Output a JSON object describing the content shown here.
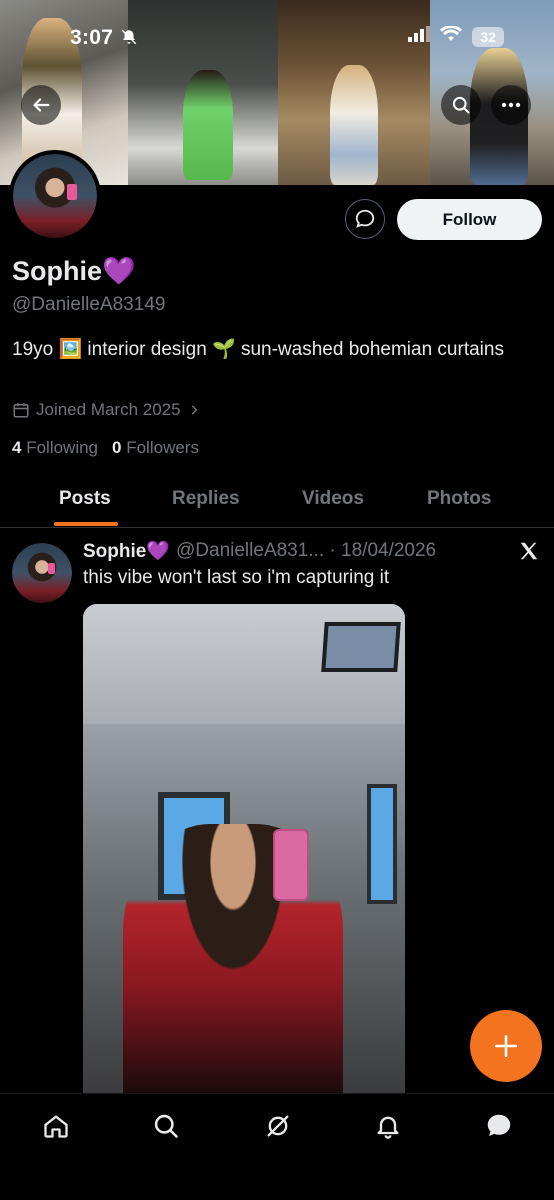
{
  "status_bar": {
    "time": "3:07",
    "battery": "32"
  },
  "profile": {
    "name": "Sophie",
    "name_emoji": "💜",
    "handle": "@DanielleA83149",
    "bio": "19yo 🖼️ interior design 🌱 sun-washed bohemian curtains",
    "joined": "Joined March 2025",
    "following_count": "4",
    "following_label": "Following",
    "followers_count": "0",
    "followers_label": "Followers"
  },
  "actions": {
    "follow_label": "Follow"
  },
  "tabs": [
    {
      "label": "Posts",
      "active": true
    },
    {
      "label": "Replies",
      "active": false
    },
    {
      "label": "Videos",
      "active": false
    },
    {
      "label": "Photos",
      "active": false
    }
  ],
  "post": {
    "author": "Sophie💜",
    "meta": "@DanielleA831... · 18/04/2026",
    "text": "this vibe won't last so i'm capturing it",
    "source_icon": "x-logo-icon"
  },
  "fab": {
    "icon": "plus-icon"
  },
  "bottom_nav": [
    {
      "icon": "home-icon"
    },
    {
      "icon": "search-icon"
    },
    {
      "icon": "grok-icon"
    },
    {
      "icon": "bell-icon"
    },
    {
      "icon": "chat-icon"
    }
  ],
  "colors": {
    "accent": "#f4731f",
    "background": "#000000",
    "text_primary": "#e7e9ea",
    "text_secondary": "#71767b",
    "follow_bg": "#eff3f4"
  }
}
